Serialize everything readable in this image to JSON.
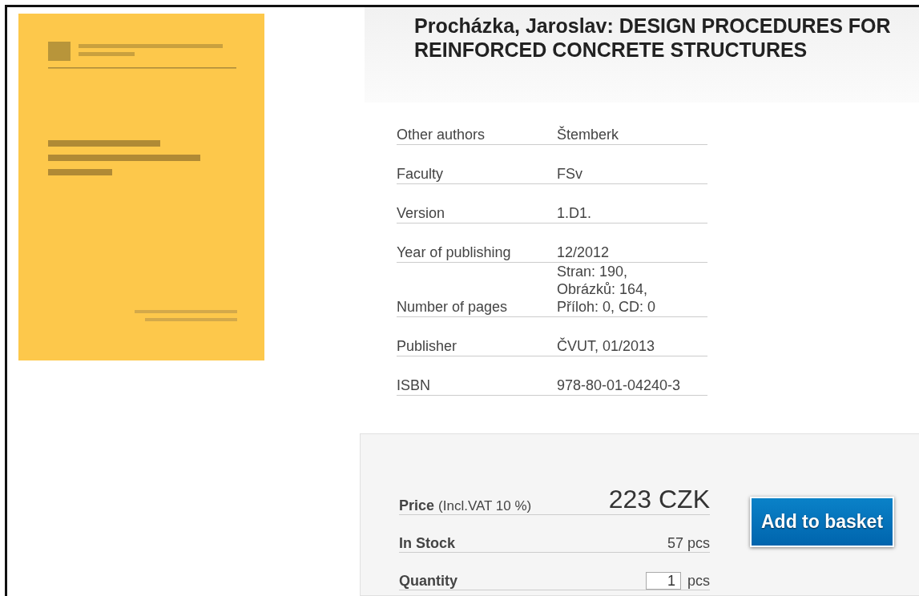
{
  "title": "Procházka, Jaroslav: DESIGN PROCEDURES FOR REINFORCED CONCRETE STRUCTURES",
  "details": [
    {
      "label": "Other authors",
      "value": [
        "Štemberk"
      ]
    },
    {
      "label": "Faculty",
      "value": [
        "FSv"
      ]
    },
    {
      "label": "Version",
      "value": [
        "1.D1."
      ]
    },
    {
      "label": "Year of publishing",
      "value": [
        "12/2012"
      ]
    },
    {
      "label": "Number of pages",
      "value": [
        "Stran: 190,",
        "Obrázků: 164,",
        "Příloh: 0, CD: 0"
      ]
    },
    {
      "label": "Publisher",
      "value": [
        "ČVUT, 01/2013"
      ]
    },
    {
      "label": "ISBN",
      "value": [
        "978-80-01-04240-3"
      ]
    }
  ],
  "purchase": {
    "price_label": "Price",
    "price_note": "(Incl.VAT 10 %)",
    "price": "223 CZK",
    "stock_label": "In Stock",
    "stock": "57 pcs",
    "quantity_label": "Quantity",
    "quantity": "1",
    "quantity_unit": "pcs",
    "button": "Add to basket"
  }
}
